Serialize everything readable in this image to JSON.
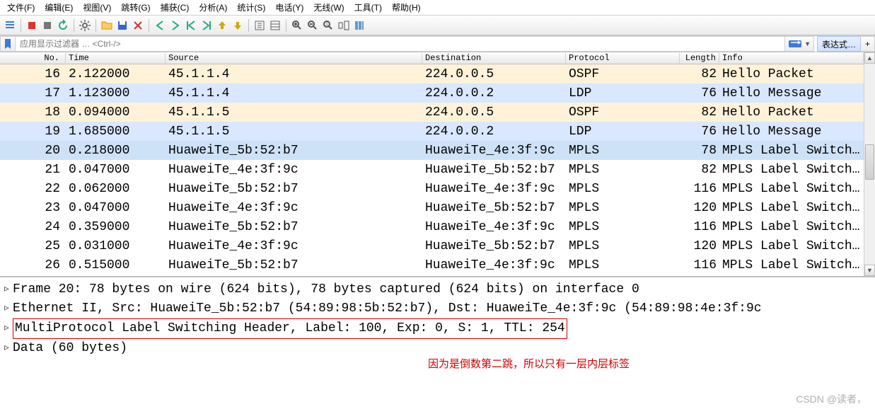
{
  "menu": [
    "文件(F)",
    "编辑(E)",
    "视图(V)",
    "跳转(G)",
    "捕获(C)",
    "分析(A)",
    "统计(S)",
    "电话(Y)",
    "无线(W)",
    "工具(T)",
    "帮助(H)"
  ],
  "toolbar_icons": [
    "list",
    "record",
    "stop",
    "restart",
    "settings",
    "folder",
    "save",
    "close",
    "prev",
    "next",
    "first",
    "last",
    "up",
    "down",
    "autoscroll",
    "list2",
    "zoom-in",
    "zoom-out",
    "zoom-reset",
    "resize",
    "columns"
  ],
  "filter": {
    "placeholder": "应用显示过滤器 … <Ctrl-/>",
    "expr_label": "表达式…"
  },
  "columns": [
    "No.",
    "Time",
    "Source",
    "Destination",
    "Protocol",
    "Length",
    "Info"
  ],
  "packets": [
    {
      "no": "16",
      "time": "2.122000",
      "src": "45.1.1.4",
      "dst": "224.0.0.5",
      "prot": "OSPF",
      "len": "82",
      "info": "Hello Packet",
      "cls": "row-ospf"
    },
    {
      "no": "17",
      "time": "1.123000",
      "src": "45.1.1.4",
      "dst": "224.0.0.2",
      "prot": "LDP",
      "len": "76",
      "info": "Hello Message",
      "cls": "row-ldp"
    },
    {
      "no": "18",
      "time": "0.094000",
      "src": "45.1.1.5",
      "dst": "224.0.0.5",
      "prot": "OSPF",
      "len": "82",
      "info": "Hello Packet",
      "cls": "row-ospf"
    },
    {
      "no": "19",
      "time": "1.685000",
      "src": "45.1.1.5",
      "dst": "224.0.0.2",
      "prot": "LDP",
      "len": "76",
      "info": "Hello Message",
      "cls": "row-ldp"
    },
    {
      "no": "20",
      "time": "0.218000",
      "src": "HuaweiTe_5b:52:b7",
      "dst": "HuaweiTe_4e:3f:9c",
      "prot": "MPLS",
      "len": "78",
      "info": "MPLS Label Switch…",
      "cls": "row-sel"
    },
    {
      "no": "21",
      "time": "0.047000",
      "src": "HuaweiTe_4e:3f:9c",
      "dst": "HuaweiTe_5b:52:b7",
      "prot": "MPLS",
      "len": "82",
      "info": "MPLS Label Switch…",
      "cls": "row-mpls"
    },
    {
      "no": "22",
      "time": "0.062000",
      "src": "HuaweiTe_5b:52:b7",
      "dst": "HuaweiTe_4e:3f:9c",
      "prot": "MPLS",
      "len": "116",
      "info": "MPLS Label Switch…",
      "cls": "row-mpls"
    },
    {
      "no": "23",
      "time": "0.047000",
      "src": "HuaweiTe_4e:3f:9c",
      "dst": "HuaweiTe_5b:52:b7",
      "prot": "MPLS",
      "len": "120",
      "info": "MPLS Label Switch…",
      "cls": "row-mpls"
    },
    {
      "no": "24",
      "time": "0.359000",
      "src": "HuaweiTe_5b:52:b7",
      "dst": "HuaweiTe_4e:3f:9c",
      "prot": "MPLS",
      "len": "116",
      "info": "MPLS Label Switch…",
      "cls": "row-mpls"
    },
    {
      "no": "25",
      "time": "0.031000",
      "src": "HuaweiTe_4e:3f:9c",
      "dst": "HuaweiTe_5b:52:b7",
      "prot": "MPLS",
      "len": "120",
      "info": "MPLS Label Switch…",
      "cls": "row-mpls"
    },
    {
      "no": "26",
      "time": "0.515000",
      "src": "HuaweiTe_5b:52:b7",
      "dst": "HuaweiTe_4e:3f:9c",
      "prot": "MPLS",
      "len": "116",
      "info": "MPLS Label Switch…",
      "cls": "row-mpls"
    }
  ],
  "details": {
    "frame": "Frame 20: 78 bytes on wire (624 bits), 78 bytes captured (624 bits) on interface 0",
    "eth": "Ethernet II, Src: HuaweiTe_5b:52:b7 (54:89:98:5b:52:b7), Dst: HuaweiTe_4e:3f:9c (54:89:98:4e:3f:9c",
    "mpls": "MultiProtocol Label Switching Header, Label: 100, Exp: 0, S: 1, TTL: 254",
    "data": "Data (60 bytes)"
  },
  "annotation": "因为是倒数第二跳，所以只有一层内层标签",
  "watermark": "CSDN @读者，"
}
